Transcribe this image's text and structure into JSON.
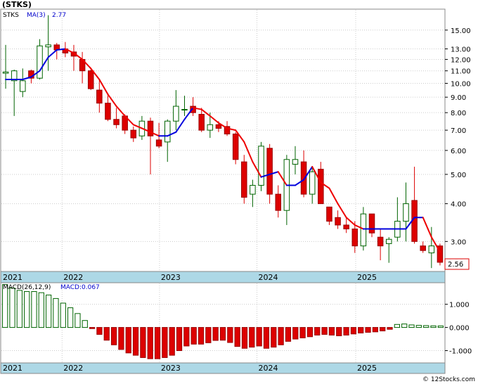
{
  "title": "(STKS)",
  "legend": {
    "symbol": "STKS",
    "ma_label": "MA(3)",
    "ma_value": "2.77"
  },
  "last_price": "2.56",
  "macd_legend": {
    "label": "MACD(26,12,9)",
    "value_label": "MACD:0.067"
  },
  "watermark": "© 12Stocks.com",
  "colors": {
    "up": "#006400",
    "down": "#dd0000",
    "ma_up": "#0000dd",
    "ma_down": "#ee0000",
    "axis_band": "#add8e6"
  },
  "chart_data": [
    {
      "type": "candlestick",
      "title": "(STKS)",
      "scale": "log",
      "ylim": [
        2.4,
        17.5
      ],
      "y_ticks": [
        "15.00",
        "13.00",
        "12.00",
        "11.00",
        "10.00",
        "9.00",
        "8.00",
        "7.00",
        "6.00",
        "5.00",
        "4.00",
        "3.00"
      ],
      "x_tick_labels": [
        "2021",
        "2022",
        "2023",
        "2024",
        "2025"
      ],
      "grid": true,
      "series": [
        {
          "name": "STKS",
          "candles": [
            {
              "o": 10.8,
              "h": 13.4,
              "l": 9.6,
              "c": 10.9
            },
            {
              "o": 10.2,
              "h": 11.1,
              "l": 7.8,
              "c": 11.0
            },
            {
              "o": 9.4,
              "h": 11.2,
              "l": 9.0,
              "c": 10.2
            },
            {
              "o": 11.0,
              "h": 11.1,
              "l": 10.0,
              "c": 10.4
            },
            {
              "o": 10.4,
              "h": 14.0,
              "l": 10.3,
              "c": 13.3
            },
            {
              "o": 13.2,
              "h": 16.8,
              "l": 11.0,
              "c": 13.4
            },
            {
              "o": 13.4,
              "h": 13.6,
              "l": 12.0,
              "c": 12.9
            },
            {
              "o": 13.0,
              "h": 13.7,
              "l": 12.2,
              "c": 12.6
            },
            {
              "o": 12.7,
              "h": 13.4,
              "l": 11.0,
              "c": 12.3
            },
            {
              "o": 12.0,
              "h": 12.7,
              "l": 10.0,
              "c": 11.0
            },
            {
              "o": 11.0,
              "h": 11.1,
              "l": 9.5,
              "c": 9.6
            },
            {
              "o": 9.5,
              "h": 10.3,
              "l": 8.0,
              "c": 8.6
            },
            {
              "o": 8.6,
              "h": 9.3,
              "l": 7.5,
              "c": 7.6
            },
            {
              "o": 7.6,
              "h": 8.3,
              "l": 7.1,
              "c": 7.3
            },
            {
              "o": 7.8,
              "h": 7.9,
              "l": 6.8,
              "c": 7.0
            },
            {
              "o": 7.0,
              "h": 7.2,
              "l": 6.4,
              "c": 6.6
            },
            {
              "o": 6.7,
              "h": 7.8,
              "l": 6.5,
              "c": 7.5
            },
            {
              "o": 7.5,
              "h": 7.7,
              "l": 5.0,
              "c": 6.7
            },
            {
              "o": 6.5,
              "h": 7.4,
              "l": 6.1,
              "c": 6.2
            },
            {
              "o": 6.4,
              "h": 7.6,
              "l": 5.5,
              "c": 7.5
            },
            {
              "o": 7.5,
              "h": 9.5,
              "l": 7.0,
              "c": 8.4
            },
            {
              "o": 8.2,
              "h": 9.1,
              "l": 7.8,
              "c": 8.2
            },
            {
              "o": 8.4,
              "h": 9.0,
              "l": 7.8,
              "c": 8.0
            },
            {
              "o": 7.9,
              "h": 8.3,
              "l": 6.9,
              "c": 7.0
            },
            {
              "o": 7.0,
              "h": 8.0,
              "l": 6.6,
              "c": 7.3
            },
            {
              "o": 7.3,
              "h": 7.5,
              "l": 6.9,
              "c": 7.1
            },
            {
              "o": 7.2,
              "h": 7.5,
              "l": 6.7,
              "c": 6.8
            },
            {
              "o": 6.8,
              "h": 6.9,
              "l": 5.4,
              "c": 5.6
            },
            {
              "o": 5.5,
              "h": 5.8,
              "l": 4.0,
              "c": 4.2
            },
            {
              "o": 4.3,
              "h": 4.8,
              "l": 3.9,
              "c": 4.6
            },
            {
              "o": 4.6,
              "h": 6.4,
              "l": 4.4,
              "c": 6.2
            },
            {
              "o": 6.1,
              "h": 6.3,
              "l": 4.0,
              "c": 4.3
            },
            {
              "o": 4.3,
              "h": 4.6,
              "l": 3.6,
              "c": 3.8
            },
            {
              "o": 3.8,
              "h": 5.8,
              "l": 3.4,
              "c": 5.6
            },
            {
              "o": 5.4,
              "h": 6.2,
              "l": 5.0,
              "c": 5.6
            },
            {
              "o": 5.5,
              "h": 6.0,
              "l": 4.2,
              "c": 4.3
            },
            {
              "o": 4.3,
              "h": 5.3,
              "l": 4.0,
              "c": 5.1
            },
            {
              "o": 5.2,
              "h": 5.5,
              "l": 4.0,
              "c": 4.0
            },
            {
              "o": 3.9,
              "h": 3.9,
              "l": 3.4,
              "c": 3.5
            },
            {
              "o": 3.6,
              "h": 3.8,
              "l": 3.3,
              "c": 3.4
            },
            {
              "o": 3.4,
              "h": 3.6,
              "l": 3.2,
              "c": 3.3
            },
            {
              "o": 3.3,
              "h": 3.5,
              "l": 2.75,
              "c": 2.9
            },
            {
              "o": 2.9,
              "h": 3.9,
              "l": 2.8,
              "c": 3.7
            },
            {
              "o": 3.7,
              "h": 3.7,
              "l": 3.1,
              "c": 3.2
            },
            {
              "o": 3.1,
              "h": 3.3,
              "l": 2.6,
              "c": 2.9
            },
            {
              "o": 2.95,
              "h": 3.1,
              "l": 2.55,
              "c": 3.05
            },
            {
              "o": 3.1,
              "h": 4.2,
              "l": 3.0,
              "c": 3.5
            },
            {
              "o": 3.5,
              "h": 4.7,
              "l": 3.0,
              "c": 4.0
            },
            {
              "o": 4.1,
              "h": 5.3,
              "l": 2.95,
              "c": 3.0
            },
            {
              "o": 2.9,
              "h": 3.0,
              "l": 2.75,
              "c": 2.8
            },
            {
              "o": 2.75,
              "h": 3.35,
              "l": 2.45,
              "c": 2.9
            },
            {
              "o": 2.9,
              "h": 2.95,
              "l": 2.5,
              "c": 2.56
            }
          ]
        },
        {
          "name": "MA(3)",
          "values": [
            10.3,
            10.3,
            10.3,
            10.5,
            11.0,
            12.2,
            12.9,
            13.0,
            12.6,
            12.0,
            11.2,
            10.3,
            9.2,
            8.4,
            7.8,
            7.3,
            7.1,
            6.9,
            6.7,
            6.7,
            6.9,
            7.6,
            8.3,
            8.2,
            7.8,
            7.4,
            7.1,
            7.0,
            6.4,
            5.5,
            4.9,
            5.0,
            5.1,
            4.6,
            4.6,
            4.8,
            5.3,
            4.7,
            4.5,
            4.0,
            3.6,
            3.4,
            3.3,
            3.3,
            3.3,
            3.3,
            3.3,
            3.3,
            3.6,
            3.6,
            3.1,
            2.77
          ]
        }
      ]
    },
    {
      "type": "bar",
      "title": "MACD(26,12,9)",
      "ylim": [
        -1.5,
        1.9
      ],
      "y_ticks": [
        "1.000",
        "0.000",
        "-1.000"
      ],
      "x_tick_labels": [
        "2021",
        "2022",
        "2023",
        "2024",
        "2025"
      ],
      "series": [
        {
          "name": "MACD",
          "values": [
            1.85,
            1.7,
            1.6,
            1.55,
            1.55,
            1.5,
            1.4,
            1.25,
            1.05,
            0.85,
            0.6,
            0.3,
            -0.05,
            -0.3,
            -0.55,
            -0.75,
            -0.95,
            -1.1,
            -1.2,
            -1.3,
            -1.35,
            -1.35,
            -1.3,
            -1.2,
            -1.0,
            -0.8,
            -0.72,
            -0.72,
            -0.66,
            -0.56,
            -0.55,
            -0.65,
            -0.82,
            -0.9,
            -0.85,
            -0.8,
            -0.9,
            -0.85,
            -0.75,
            -0.6,
            -0.5,
            -0.45,
            -0.4,
            -0.33,
            -0.3,
            -0.33,
            -0.36,
            -0.33,
            -0.28,
            -0.24,
            -0.21,
            -0.19,
            -0.15,
            -0.08,
            0.13,
            0.15,
            0.11,
            0.09,
            0.08,
            0.07,
            0.067
          ]
        }
      ]
    }
  ]
}
